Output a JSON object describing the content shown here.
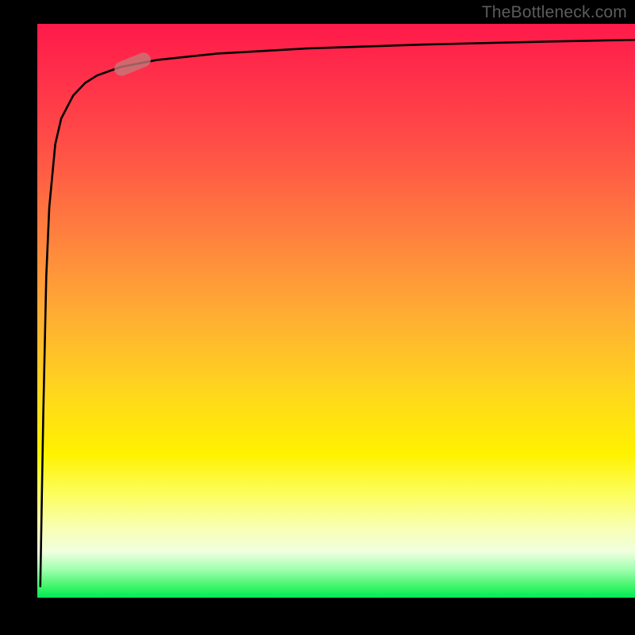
{
  "attribution": {
    "text": "TheBottleneck.com"
  },
  "chart_data": {
    "type": "line",
    "title": "",
    "xlabel": "",
    "ylabel": "",
    "xlim": [
      0,
      100
    ],
    "ylim": [
      0,
      100
    ],
    "gradient_stops": [
      {
        "pos": 0.0,
        "color": "#ff1a4a"
      },
      {
        "pos": 0.22,
        "color": "#ff5146"
      },
      {
        "pos": 0.51,
        "color": "#ffae33"
      },
      {
        "pos": 0.75,
        "color": "#fff200"
      },
      {
        "pos": 0.92,
        "color": "#f0ffdf"
      },
      {
        "pos": 1.0,
        "color": "#00eb55"
      }
    ],
    "series": [
      {
        "name": "bottleneck-curve",
        "x": [
          0.5,
          1,
          1.5,
          2,
          3,
          4,
          6,
          8,
          10,
          14,
          20,
          30,
          45,
          65,
          85,
          100
        ],
        "values": [
          2,
          32,
          56,
          68,
          79,
          83.5,
          87.5,
          89.7,
          91,
          92.5,
          93.7,
          94.8,
          95.7,
          96.4,
          96.9,
          97.2
        ]
      }
    ],
    "marker": {
      "x": 16,
      "y": 93,
      "angle_deg": -22
    }
  }
}
